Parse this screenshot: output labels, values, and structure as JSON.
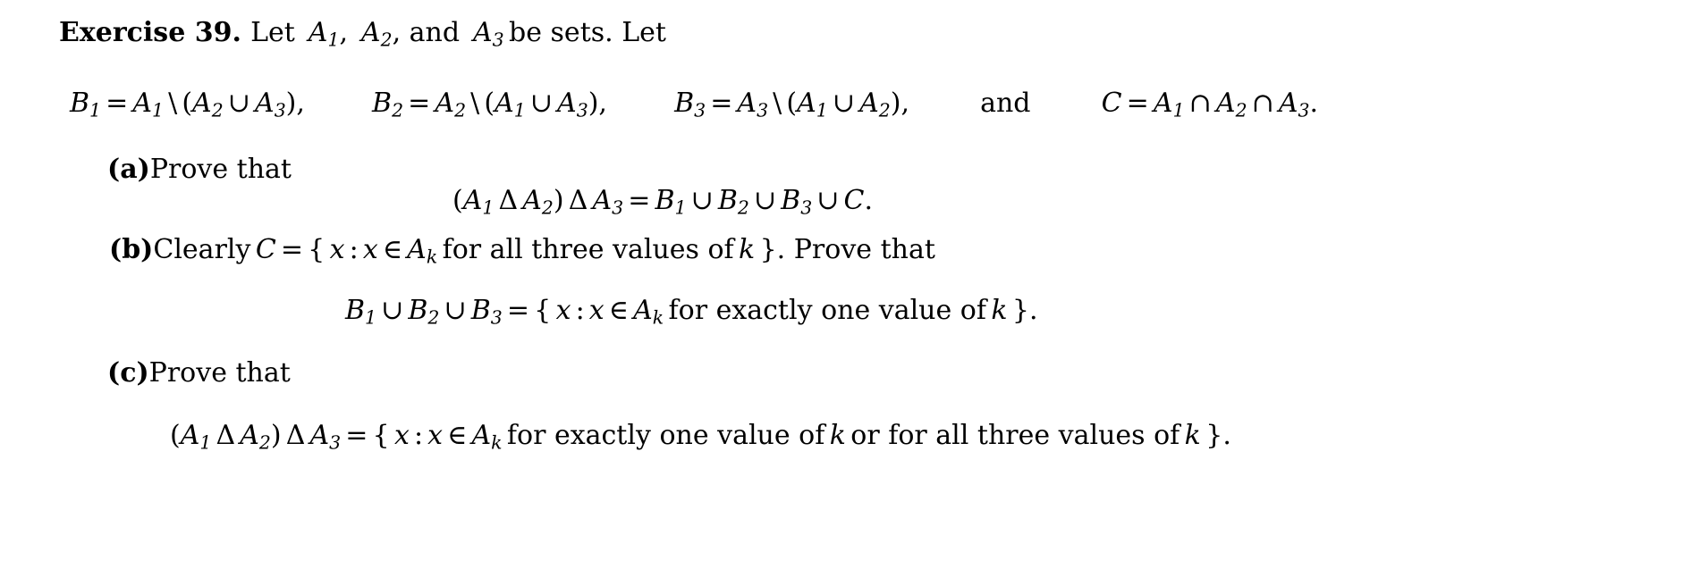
{
  "document": {
    "exercise": {
      "label": "Exercise 39.",
      "statement_pre": "Let",
      "set_a1": "A",
      "set_a1_sub": "1",
      "comma1": ",",
      "set_a2": "A",
      "set_a2_sub": "2",
      "comma2": ", and",
      "set_a3": "A",
      "set_a3_sub": "3",
      "statement_post": "be sets.  Let"
    },
    "definitions": {
      "b1": {
        "lhs": "B",
        "lhs_sub": "1",
        "eq": "=",
        "set": "A",
        "set_sub": "1",
        "setminus": "\\",
        "open": "(",
        "arg1": "A",
        "arg1_sub": "2",
        "union": "∪",
        "arg2": "A",
        "arg2_sub": "3",
        "close": ")",
        "punct": ","
      },
      "b2": {
        "lhs": "B",
        "lhs_sub": "2",
        "eq": "=",
        "set": "A",
        "set_sub": "2",
        "setminus": "\\",
        "open": "(",
        "arg1": "A",
        "arg1_sub": "1",
        "union": "∪",
        "arg2": "A",
        "arg2_sub": "3",
        "close": ")",
        "punct": ","
      },
      "b3": {
        "lhs": "B",
        "lhs_sub": "3",
        "eq": "=",
        "set": "A",
        "set_sub": "3",
        "setminus": "\\",
        "open": "(",
        "arg1": "A",
        "arg1_sub": "1",
        "union": "∪",
        "arg2": "A",
        "arg2_sub": "2",
        "close": ")",
        "punct": ","
      },
      "conjunction": "and",
      "c": {
        "lhs": "C",
        "eq": "=",
        "arg1": "A",
        "arg1_sub": "1",
        "intersect1": "∩",
        "arg2": "A",
        "arg2_sub": "2",
        "intersect2": "∩",
        "arg3": "A",
        "arg3_sub": "3",
        "punct": "."
      }
    },
    "parts": [
      {
        "label": "(a)",
        "text": "Prove that",
        "equation": {
          "open": "(",
          "a1": "A",
          "a1_sub": "1",
          "delta1": "Δ",
          "a2": "A",
          "a2_sub": "2",
          "close": ")",
          "delta2": "Δ",
          "a3": "A",
          "a3_sub": "3",
          "eq": "=",
          "b1": "B",
          "b1_sub": "1",
          "union1": "∪",
          "b2": "B",
          "b2_sub": "2",
          "union2": "∪",
          "b3": "B",
          "b3_sub": "3",
          "union3": "∪",
          "c": "C",
          "punct": "."
        }
      },
      {
        "label": "(b)",
        "text_pre": "Clearly",
        "c_symbol": "C",
        "eq": "=",
        "brace_open": "{",
        "x1": "x",
        "colon": ":",
        "x2": "x",
        "elem": "∈",
        "set_a": "A",
        "set_a_sub": "k",
        "condition": "for all three values of",
        "k_symbol": "k",
        "brace_close": "}",
        "text_post": ".  Prove that",
        "equation": {
          "b1": "B",
          "b1_sub": "1",
          "union1": "∪",
          "b2": "B",
          "b2_sub": "2",
          "union2": "∪",
          "b3": "B",
          "b3_sub": "3",
          "eq": "=",
          "brace_open": "{",
          "x1": "x",
          "colon": ":",
          "x2": "x",
          "elem": "∈",
          "set_a": "A",
          "set_a_sub": "k",
          "condition": "for exactly one value of",
          "k_symbol": "k",
          "brace_close": "}",
          "punct": "."
        }
      },
      {
        "label": "(c)",
        "text": "Prove that",
        "equation": {
          "open": "(",
          "a1": "A",
          "a1_sub": "1",
          "delta1": "Δ",
          "a2": "A",
          "a2_sub": "2",
          "close": ")",
          "delta2": "Δ",
          "a3": "A",
          "a3_sub": "3",
          "eq": "=",
          "brace_open": "{",
          "x1": "x",
          "colon": ":",
          "x2": "x",
          "elem": "∈",
          "set_a": "A",
          "set_a_sub": "k",
          "condition1": "for exactly one value of",
          "k1": "k",
          "condition2": "or for all three values of",
          "k2": "k",
          "brace_close": "}",
          "punct": "."
        }
      }
    ]
  }
}
